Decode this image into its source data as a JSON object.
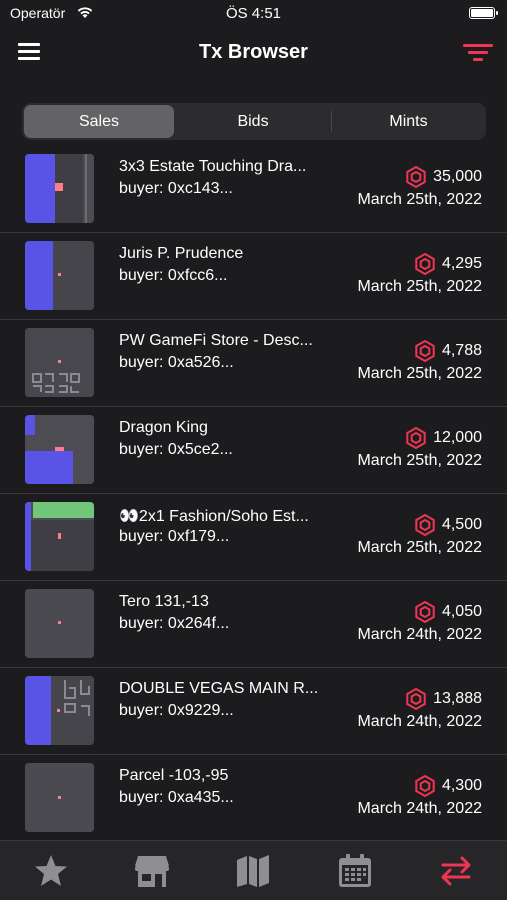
{
  "status": {
    "carrier": "Operatör",
    "time": "ÖS 4:51"
  },
  "nav": {
    "title": "Tx Browser"
  },
  "segments": [
    "Sales",
    "Bids",
    "Mints"
  ],
  "active_segment": "Sales",
  "colors": {
    "accent": "#ef3553",
    "background": "#1c1c1e",
    "tab_inactive": "#8e8e93"
  },
  "sales": [
    {
      "name": "3x3 Estate Touching Dra...",
      "buyer": "buyer: 0xc143...",
      "price": "35,000",
      "date": "March 25th, 2022"
    },
    {
      "name": "Juris P. Prudence",
      "buyer": "buyer: 0xfcc6...",
      "price": "4,295",
      "date": "March 25th, 2022"
    },
    {
      "name": "PW GameFi Store - Desc...",
      "buyer": "buyer: 0xa526...",
      "price": "4,788",
      "date": "March 25th, 2022"
    },
    {
      "name": "Dragon King",
      "buyer": "buyer: 0x5ce2...",
      "price": "12,000",
      "date": "March 25th, 2022"
    },
    {
      "name": "👀2x1 Fashion/Soho Est...",
      "buyer": "buyer: 0xf179...",
      "price": "4,500",
      "date": "March 25th, 2022"
    },
    {
      "name": "Tero 131,-13",
      "buyer": "buyer: 0x264f...",
      "price": "4,050",
      "date": "March 24th, 2022"
    },
    {
      "name": "DOUBLE VEGAS MAIN R...",
      "buyer": "buyer: 0x9229...",
      "price": "13,888",
      "date": "March 24th, 2022"
    },
    {
      "name": "Parcel -103,-95",
      "buyer": "buyer: 0xa435...",
      "price": "4,300",
      "date": "March 24th, 2022"
    }
  ],
  "tabs": [
    {
      "icon": "star-icon"
    },
    {
      "icon": "store-icon"
    },
    {
      "icon": "map-icon"
    },
    {
      "icon": "calendar-icon"
    },
    {
      "icon": "transfer-arrows-icon",
      "active": true
    }
  ]
}
